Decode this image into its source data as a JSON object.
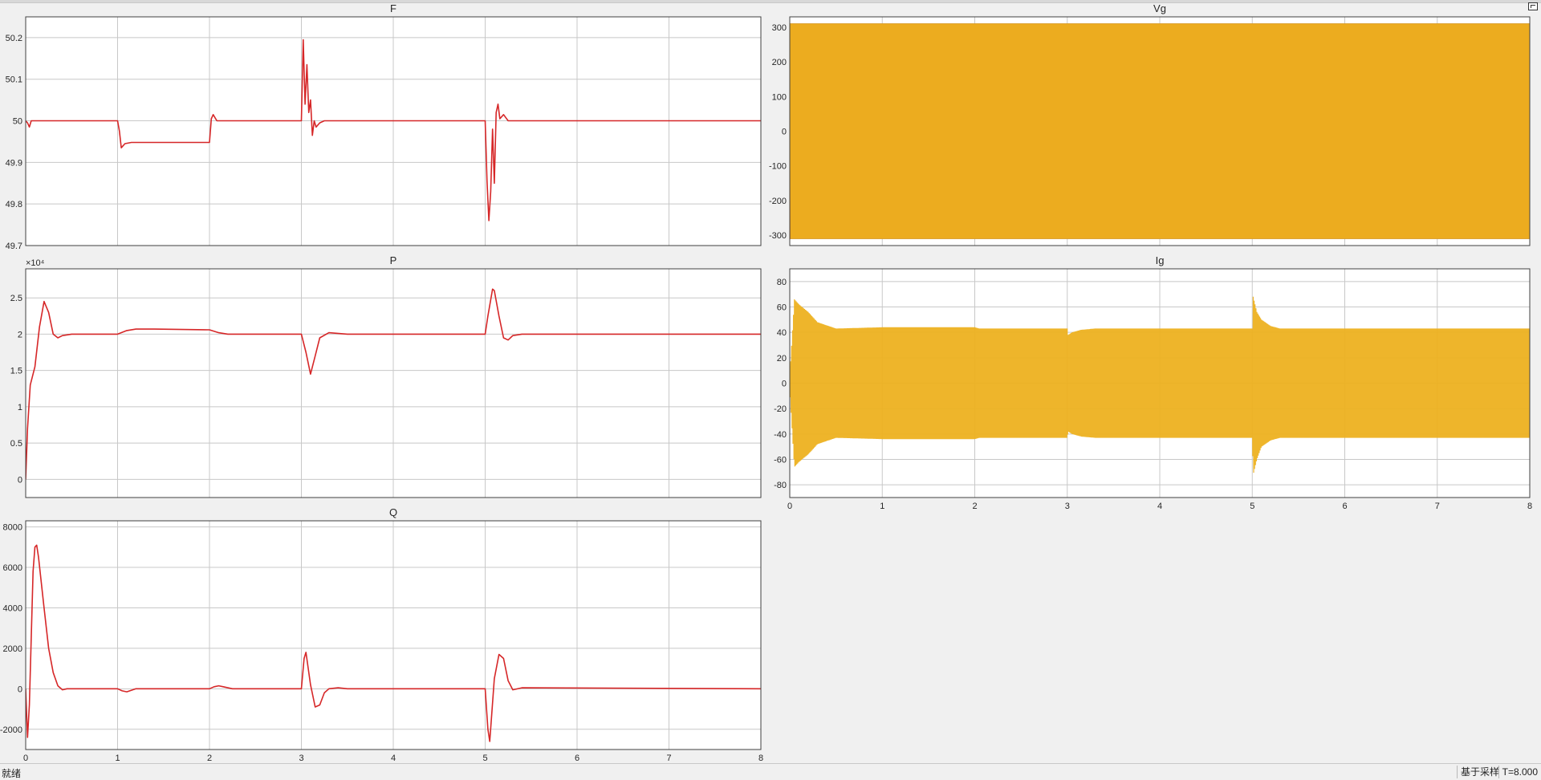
{
  "colors": {
    "background": "#f0f0f0",
    "axes_face": "#ffffff",
    "grid": "#c8c8c8",
    "red": "#d62728",
    "yellow": "#edb120",
    "orange": "#d95319",
    "blue": "#0072bd"
  },
  "statusbar": {
    "status": "就绪",
    "mode": "基于采样",
    "time": "T=8.000"
  },
  "chart_data": [
    {
      "id": "F",
      "type": "line",
      "title": "F",
      "xlim": [
        0,
        8
      ],
      "ylim": [
        49.7,
        50.25
      ],
      "xticks": [
        0,
        1,
        2,
        3,
        4,
        5,
        6,
        7,
        8
      ],
      "xticklabels": [],
      "yticks": [
        49.7,
        49.8,
        49.9,
        50,
        50.1,
        50.2
      ],
      "yticklabels": [
        "49.7",
        "49.8",
        "49.9",
        "50",
        "50.1",
        "50.2"
      ],
      "grid": true,
      "series": [
        {
          "color": "#d62728",
          "x": [
            0,
            0.02,
            0.04,
            0.06,
            0.1,
            1.0,
            1.02,
            1.04,
            1.08,
            1.15,
            2.0,
            2.02,
            2.04,
            2.08,
            3.0,
            3.02,
            3.04,
            3.06,
            3.08,
            3.1,
            3.12,
            3.14,
            3.16,
            3.2,
            3.25,
            3.35,
            5.0,
            5.02,
            5.04,
            5.06,
            5.08,
            5.1,
            5.12,
            5.14,
            5.16,
            5.2,
            5.25,
            5.35,
            8.0
          ],
          "y": [
            50,
            49.995,
            49.985,
            50.0,
            50,
            50,
            49.975,
            49.935,
            49.945,
            49.948,
            49.948,
            50.005,
            50.015,
            50.0,
            50,
            50.195,
            50.04,
            50.135,
            50.02,
            50.05,
            49.965,
            50.0,
            49.985,
            49.995,
            50.0,
            50.0,
            50,
            49.855,
            49.76,
            49.83,
            49.98,
            49.85,
            50.02,
            50.04,
            50.005,
            50.015,
            50.0,
            50.0,
            50.0
          ]
        }
      ]
    },
    {
      "id": "Vg",
      "type": "line",
      "title": "Vg",
      "xlim": [
        0,
        8
      ],
      "ylim": [
        -330,
        330
      ],
      "xticks": [
        0,
        1,
        2,
        3,
        4,
        5,
        6,
        7,
        8
      ],
      "xticklabels": [],
      "yticks": [
        -300,
        -200,
        -100,
        0,
        100,
        200,
        300
      ],
      "yticklabels": [
        "-300",
        "-200",
        "-100",
        "0",
        "100",
        "200",
        "300"
      ],
      "grid": true,
      "fill": "oscillating band (three phases, 50 Hz)",
      "series": [
        {
          "color": "#0072bd",
          "x": [
            0,
            8
          ],
          "upper": [
            311,
            311
          ],
          "lower": [
            -311,
            -311
          ]
        },
        {
          "color": "#d95319",
          "x": [
            0,
            8
          ],
          "upper": [
            311,
            311
          ],
          "lower": [
            -311,
            -311
          ]
        },
        {
          "color": "#edb120",
          "x": [
            0,
            8
          ],
          "upper": [
            311,
            311
          ],
          "lower": [
            -311,
            -311
          ]
        }
      ]
    },
    {
      "id": "P",
      "type": "line",
      "title": "P",
      "xlim": [
        0,
        8
      ],
      "ylim": [
        -0.25,
        2.9
      ],
      "exponent": "×10⁴",
      "xticks": [
        0,
        1,
        2,
        3,
        4,
        5,
        6,
        7,
        8
      ],
      "xticklabels": [],
      "yticks": [
        0,
        0.5,
        1,
        1.5,
        2,
        2.5
      ],
      "yticklabels": [
        "0",
        "0.5",
        "1",
        "1.5",
        "2",
        "2.5"
      ],
      "grid": true,
      "series": [
        {
          "color": "#d62728",
          "x": [
            0,
            0.02,
            0.05,
            0.1,
            0.15,
            0.2,
            0.25,
            0.3,
            0.35,
            0.4,
            0.5,
            1.0,
            1.1,
            1.2,
            1.4,
            2.0,
            2.1,
            2.2,
            2.4,
            3.0,
            3.05,
            3.1,
            3.15,
            3.2,
            3.3,
            3.5,
            5.0,
            5.03,
            5.08,
            5.1,
            5.15,
            5.2,
            5.25,
            5.3,
            5.4,
            8.0
          ],
          "y": [
            0,
            0.7,
            1.3,
            1.55,
            2.1,
            2.45,
            2.3,
            2.0,
            1.95,
            1.98,
            2.0,
            2.0,
            2.05,
            2.07,
            2.07,
            2.06,
            2.02,
            2.0,
            2.0,
            2.0,
            1.75,
            1.45,
            1.7,
            1.95,
            2.02,
            2.0,
            2.0,
            2.25,
            2.62,
            2.6,
            2.25,
            1.95,
            1.92,
            1.98,
            2.0,
            2.0
          ]
        }
      ]
    },
    {
      "id": "Ig",
      "type": "line",
      "title": "Ig",
      "xlim": [
        0,
        8
      ],
      "ylim": [
        -90,
        90
      ],
      "xticks": [
        0,
        1,
        2,
        3,
        4,
        5,
        6,
        7,
        8
      ],
      "xticklabels": [
        "0",
        "1",
        "2",
        "3",
        "4",
        "5",
        "6",
        "7",
        "8"
      ],
      "yticks": [
        -80,
        -60,
        -40,
        -20,
        0,
        20,
        40,
        60,
        80
      ],
      "yticklabels": [
        "-80",
        "-60",
        "-40",
        "-20",
        "0",
        "20",
        "40",
        "60",
        "80"
      ],
      "grid": true,
      "fill": "oscillating band (three phases, 50 Hz)",
      "series": [
        {
          "color": "#edb120",
          "x": [
            0,
            0.05,
            0.1,
            0.2,
            0.3,
            0.5,
            1.0,
            2.0,
            2.05,
            3.0,
            3.01,
            3.05,
            3.15,
            3.3,
            5.0,
            5.01,
            5.05,
            5.1,
            5.2,
            5.3,
            8.0
          ],
          "upper": [
            5,
            66,
            62,
            56,
            48,
            43,
            44,
            44,
            43,
            43,
            38,
            40,
            42,
            43,
            43,
            68,
            56,
            50,
            45,
            43,
            43
          ],
          "lower": [
            -5,
            -66,
            -62,
            -56,
            -48,
            -43,
            -44,
            -44,
            -43,
            -43,
            -38,
            -40,
            -42,
            -43,
            -43,
            -72,
            -60,
            -50,
            -45,
            -43,
            -43
          ]
        }
      ]
    },
    {
      "id": "Q",
      "type": "line",
      "title": "Q",
      "xlim": [
        0,
        8
      ],
      "ylim": [
        -3000,
        8300
      ],
      "xticks": [
        0,
        1,
        2,
        3,
        4,
        5,
        6,
        7,
        8
      ],
      "xticklabels": [
        "0",
        "1",
        "2",
        "3",
        "4",
        "5",
        "6",
        "7",
        "8"
      ],
      "yticks": [
        -2000,
        0,
        2000,
        4000,
        6000,
        8000
      ],
      "yticklabels": [
        "-2000",
        "0",
        "2000",
        "4000",
        "6000",
        "8000"
      ],
      "grid": true,
      "series": [
        {
          "color": "#d62728",
          "x": [
            0,
            0.02,
            0.04,
            0.06,
            0.08,
            0.1,
            0.12,
            0.14,
            0.2,
            0.25,
            0.3,
            0.35,
            0.4,
            0.45,
            0.5,
            1.0,
            1.05,
            1.1,
            1.2,
            2.0,
            2.05,
            2.1,
            2.15,
            2.25,
            3.0,
            3.03,
            3.05,
            3.1,
            3.15,
            3.2,
            3.25,
            3.3,
            3.4,
            3.5,
            5.0,
            5.03,
            5.05,
            5.1,
            5.15,
            5.2,
            5.25,
            5.3,
            5.4,
            8.0
          ],
          "y": [
            0,
            -2400,
            -800,
            2500,
            5800,
            7000,
            7100,
            6500,
            4000,
            2000,
            800,
            150,
            -50,
            0,
            0,
            0,
            -100,
            -150,
            0,
            0,
            100,
            150,
            100,
            0,
            0,
            1500,
            1800,
            200,
            -900,
            -800,
            -200,
            0,
            50,
            0,
            0,
            -2000,
            -2600,
            500,
            1700,
            1500,
            400,
            -50,
            50,
            0
          ]
        }
      ]
    }
  ]
}
